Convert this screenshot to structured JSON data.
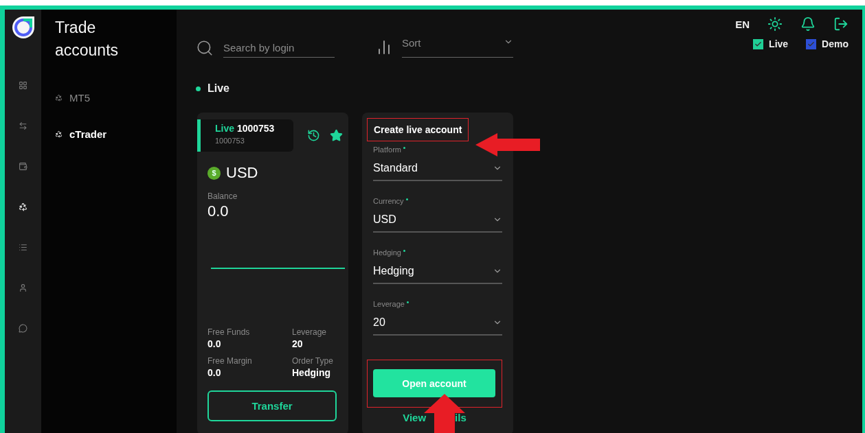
{
  "rail": [
    {
      "selected": false
    },
    {
      "selected": false
    },
    {
      "selected": false
    },
    {
      "selected": true
    },
    {
      "selected": false
    },
    {
      "selected": false
    },
    {
      "selected": false
    }
  ],
  "sidebar": {
    "title": "Trade accounts",
    "items": [
      {
        "label": "MT5",
        "selected": false
      },
      {
        "label": "cTrader",
        "selected": true
      }
    ]
  },
  "toolbar": {
    "search": {
      "placeholder": "Search by login"
    },
    "sort": {
      "placeholder": "Sort"
    }
  },
  "header": {
    "language": "EN",
    "filters": [
      {
        "label": "Live",
        "checked": true,
        "color": "#1fcf95"
      },
      {
        "label": "Demo",
        "checked": true,
        "color": "#2d4fd6"
      }
    ]
  },
  "section": {
    "label": "Live"
  },
  "account": {
    "type": "Live",
    "number": "1000753",
    "login": "1000753",
    "favorite": true,
    "currency_symbol": "$",
    "currency": "USD",
    "balance_label": "Balance",
    "balance": "0.0",
    "stats": [
      {
        "label": "Free Funds",
        "value": "0.0"
      },
      {
        "label": "Leverage",
        "value": "20"
      },
      {
        "label": "Free Margin",
        "value": "0.0"
      },
      {
        "label": "Order Type",
        "value": "Hedging"
      }
    ],
    "button": "Transfer"
  },
  "create_form": {
    "title": "Create live account",
    "fields": [
      {
        "label": "Platform",
        "value": "Standard"
      },
      {
        "label": "Currency",
        "value": "USD"
      },
      {
        "label": "Hedging",
        "value": "Hedging"
      },
      {
        "label": "Leverage",
        "value": "20"
      }
    ],
    "button": "Open account",
    "link_parts": [
      "View",
      "ils"
    ]
  }
}
